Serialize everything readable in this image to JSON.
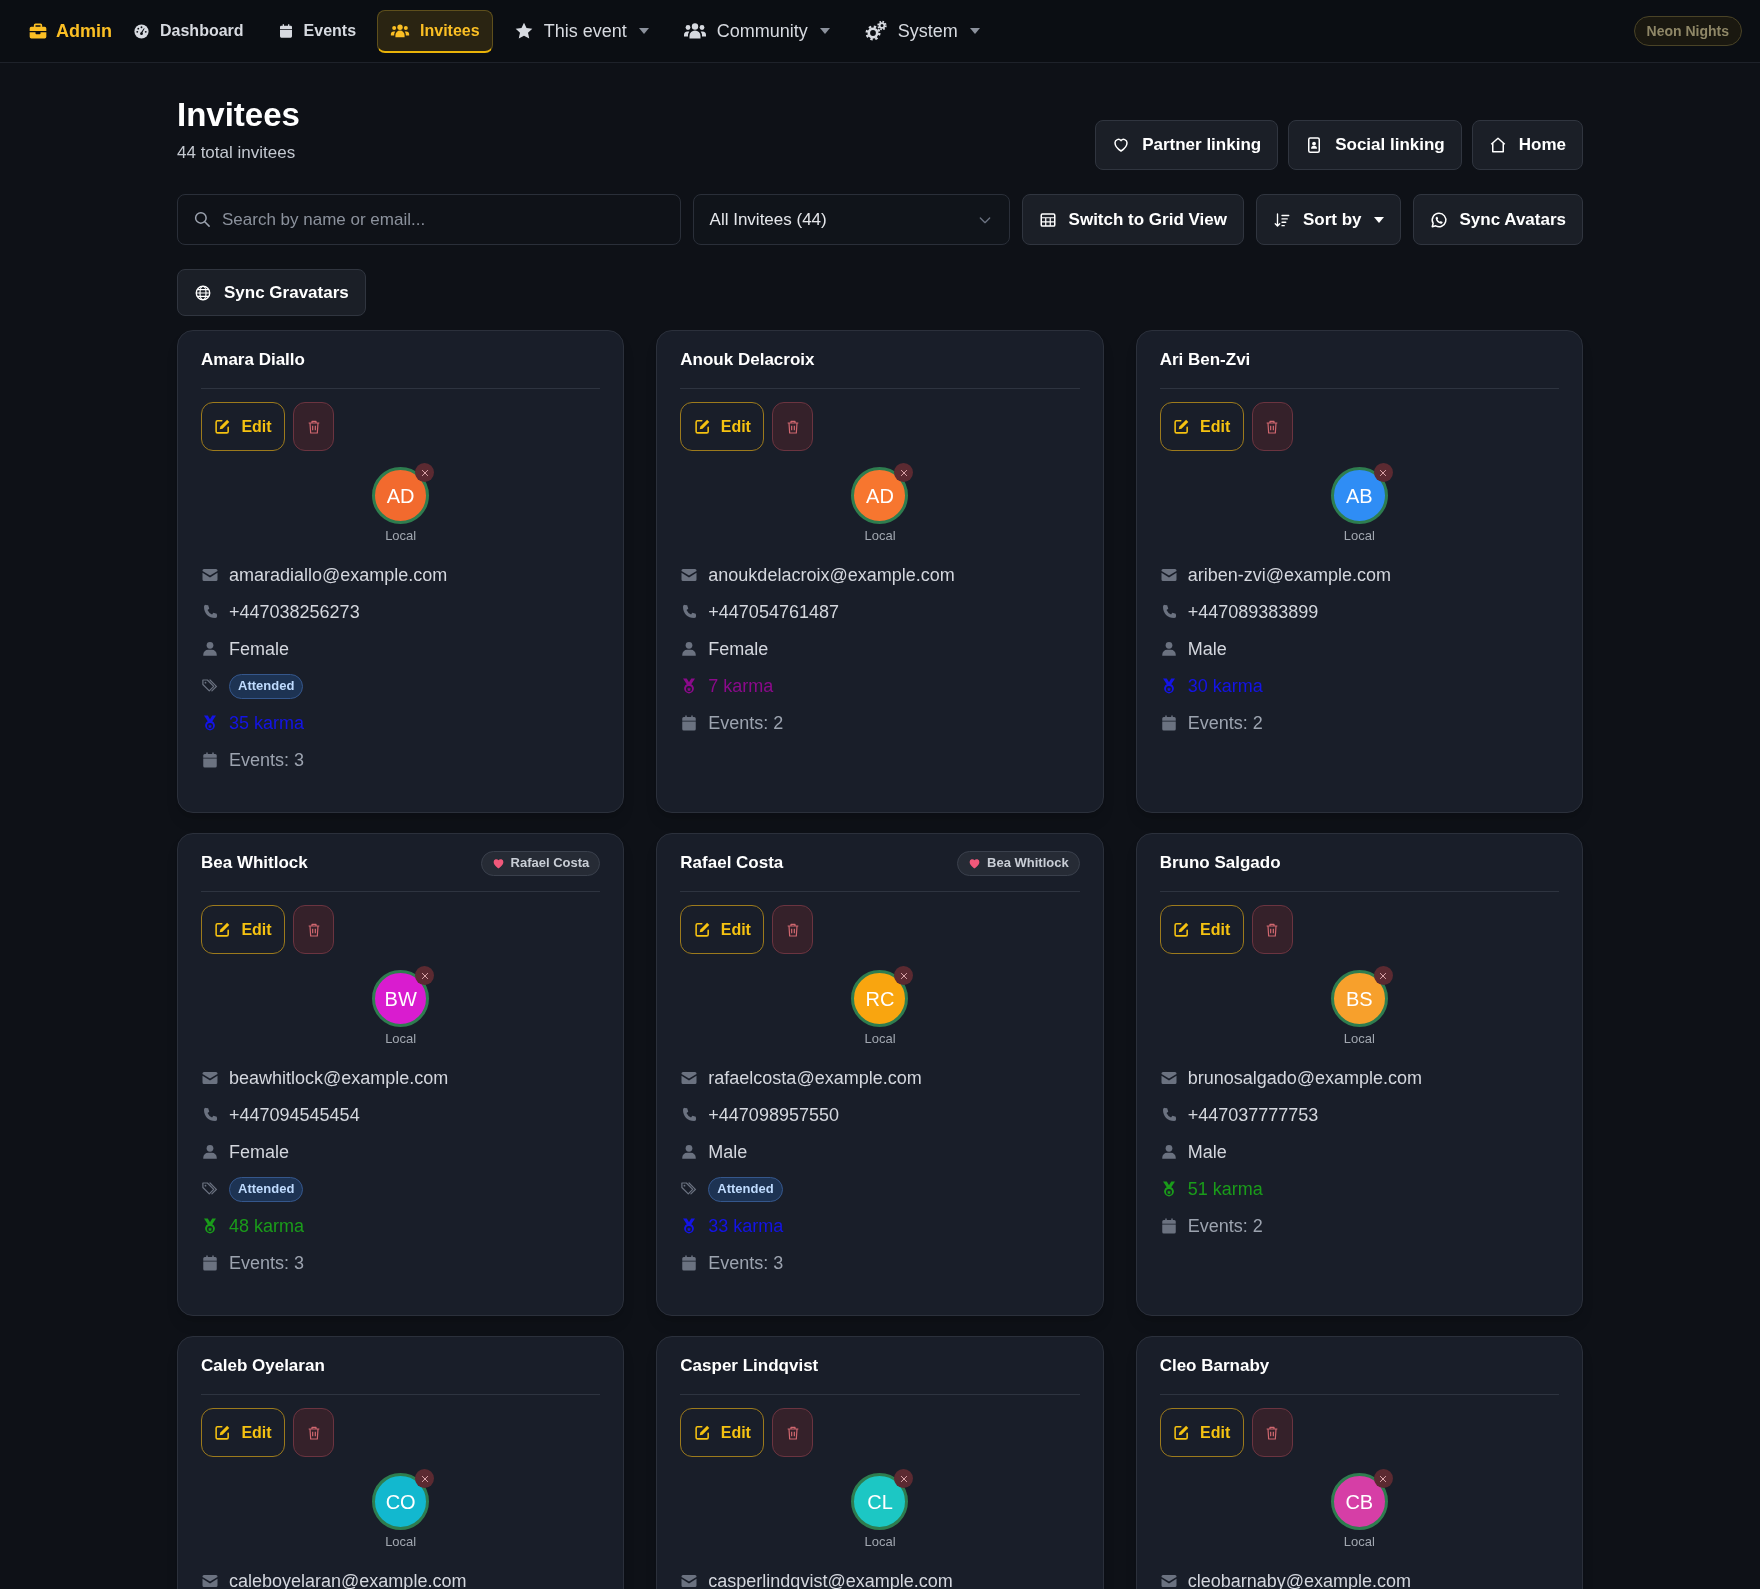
{
  "nav": {
    "brand": "Admin",
    "items": [
      {
        "label": "Dashboard",
        "selected": false,
        "dropdown": false
      },
      {
        "label": "Events",
        "selected": false,
        "dropdown": false
      },
      {
        "label": "Invitees",
        "selected": true,
        "dropdown": false
      },
      {
        "label": "This event",
        "selected": false,
        "dropdown": true
      },
      {
        "label": "Community",
        "selected": false,
        "dropdown": true
      },
      {
        "label": "System",
        "selected": false,
        "dropdown": true
      }
    ],
    "event_badge": "Neon Nights"
  },
  "header": {
    "title": "Invitees",
    "subtitle": "44 total invitees",
    "actions": [
      {
        "label": "Partner linking"
      },
      {
        "label": "Social linking"
      },
      {
        "label": "Home"
      }
    ]
  },
  "toolbar": {
    "search": {
      "placeholder": "Search by name or email..."
    },
    "filter": {
      "value": "All Invitees (44)"
    },
    "buttons": [
      {
        "label": "Switch to Grid View",
        "dropdown": false
      },
      {
        "label": "Sort by",
        "dropdown": true
      },
      {
        "label": "Sync Avatars",
        "dropdown": false
      },
      {
        "label": "Sync Gravatars",
        "dropdown": false
      }
    ]
  },
  "invitees": [
    {
      "name": "Amara Diallo",
      "edit": "Edit",
      "avatar": {
        "initials": "AD",
        "color": "#f26a2e",
        "source": "Local"
      },
      "email": "amaradiallo@example.com",
      "phone": "+447038256273",
      "gender": "Female",
      "tags": [
        "Attended"
      ],
      "karma": {
        "text": "35 karma",
        "color": "#1414e6"
      },
      "events": "Events: 3"
    },
    {
      "name": "Anouk Delacroix",
      "edit": "Edit",
      "avatar": {
        "initials": "AD",
        "color": "#f7762f",
        "source": "Local"
      },
      "email": "anoukdelacroix@example.com",
      "phone": "+447054761487",
      "gender": "Female",
      "karma": {
        "text": "7 karma",
        "color": "#8b0a8b"
      },
      "events": "Events: 2"
    },
    {
      "name": "Ari Ben-Zvi",
      "edit": "Edit",
      "avatar": {
        "initials": "AB",
        "color": "#2f8df5",
        "source": "Local"
      },
      "email": "ariben-zvi@example.com",
      "phone": "+447089383899",
      "gender": "Male",
      "karma": {
        "text": "30 karma",
        "color": "#1414e6"
      },
      "events": "Events: 2"
    },
    {
      "name": "Bea Whitlock",
      "partner": "Rafael Costa",
      "edit": "Edit",
      "avatar": {
        "initials": "BW",
        "color": "#d91ccf",
        "source": "Local"
      },
      "email": "beawhitlock@example.com",
      "phone": "+447094545454",
      "gender": "Female",
      "tags": [
        "Attended"
      ],
      "karma": {
        "text": "48 karma",
        "color": "#1a9c1a"
      },
      "events": "Events: 3"
    },
    {
      "name": "Rafael Costa",
      "partner": "Bea Whitlock",
      "edit": "Edit",
      "avatar": {
        "initials": "RC",
        "color": "#f9a50f",
        "source": "Local"
      },
      "email": "rafaelcosta@example.com",
      "phone": "+447098957550",
      "gender": "Male",
      "tags": [
        "Attended"
      ],
      "karma": {
        "text": "33 karma",
        "color": "#1414e6"
      },
      "events": "Events: 3"
    },
    {
      "name": "Bruno Salgado",
      "edit": "Edit",
      "avatar": {
        "initials": "BS",
        "color": "#f7a02c",
        "source": "Local"
      },
      "email": "brunosalgado@example.com",
      "phone": "+447037777753",
      "gender": "Male",
      "karma": {
        "text": "51 karma",
        "color": "#1a9c1a"
      },
      "events": "Events: 2"
    },
    {
      "name": "Caleb Oyelaran",
      "edit": "Edit",
      "avatar": {
        "initials": "CO",
        "color": "#12b8cf",
        "source": "Local"
      },
      "email": "caleboyelaran@example.com"
    },
    {
      "name": "Casper Lindqvist",
      "edit": "Edit",
      "avatar": {
        "initials": "CL",
        "color": "#1cc7c4",
        "source": "Local"
      },
      "email": "casperlindqvist@example.com"
    },
    {
      "name": "Cleo Barnaby",
      "edit": "Edit",
      "avatar": {
        "initials": "CB",
        "color": "#d63ea6",
        "source": "Local"
      },
      "email": "cleobarnaby@example.com"
    }
  ]
}
